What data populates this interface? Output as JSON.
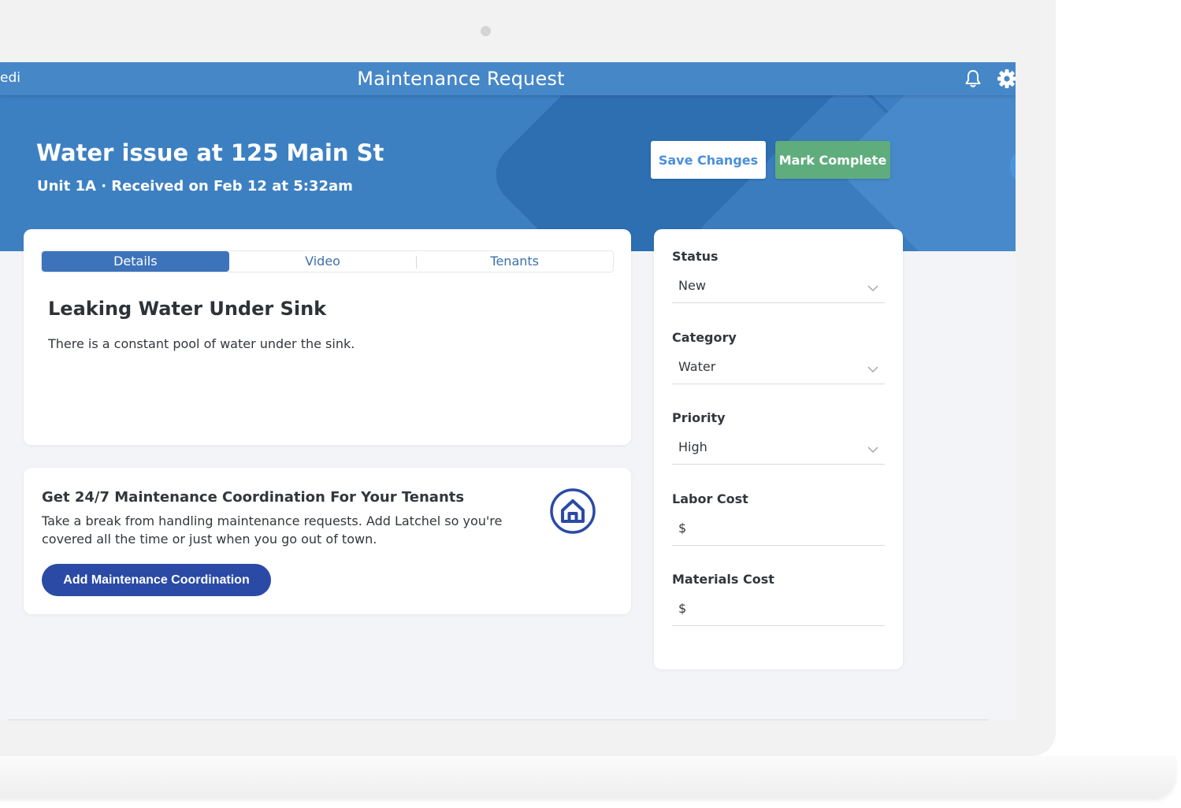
{
  "app": {
    "brand_fragment": "edi",
    "title": "Maintenance Request"
  },
  "request": {
    "title": "Water issue at 125 Main St",
    "subtitle": "Unit 1A · Received on Feb 12 at 5:32am",
    "save_label": "Save Changes",
    "complete_label": "Mark Complete"
  },
  "tabs": [
    {
      "label": "Details",
      "active": true
    },
    {
      "label": "Video",
      "active": false
    },
    {
      "label": "Tenants",
      "active": false
    }
  ],
  "details": {
    "heading": "Leaking Water Under Sink",
    "description": "There is a constant pool of water under the sink."
  },
  "promo": {
    "title": "Get 24/7 Maintenance Coordination For Your Tenants",
    "body": "Take a break from handling maintenance requests. Add Latchel so you're covered all the time or just when you go out of town.",
    "button_label": "Add Maintenance Coordination",
    "icon": "house-icon"
  },
  "fields": {
    "status": {
      "label": "Status",
      "value": "New"
    },
    "category": {
      "label": "Category",
      "value": "Water"
    },
    "priority": {
      "label": "Priority",
      "value": "High"
    },
    "labor_cost": {
      "label": "Labor Cost",
      "value": "$"
    },
    "materials_cost": {
      "label": "Materials Cost",
      "value": "$"
    }
  },
  "colors": {
    "topbar": "#4687c8",
    "hero": "#3d80c2",
    "accent_blue": "#3d73bb",
    "complete_green": "#5fad7d",
    "promo_button": "#2a4aa6"
  }
}
